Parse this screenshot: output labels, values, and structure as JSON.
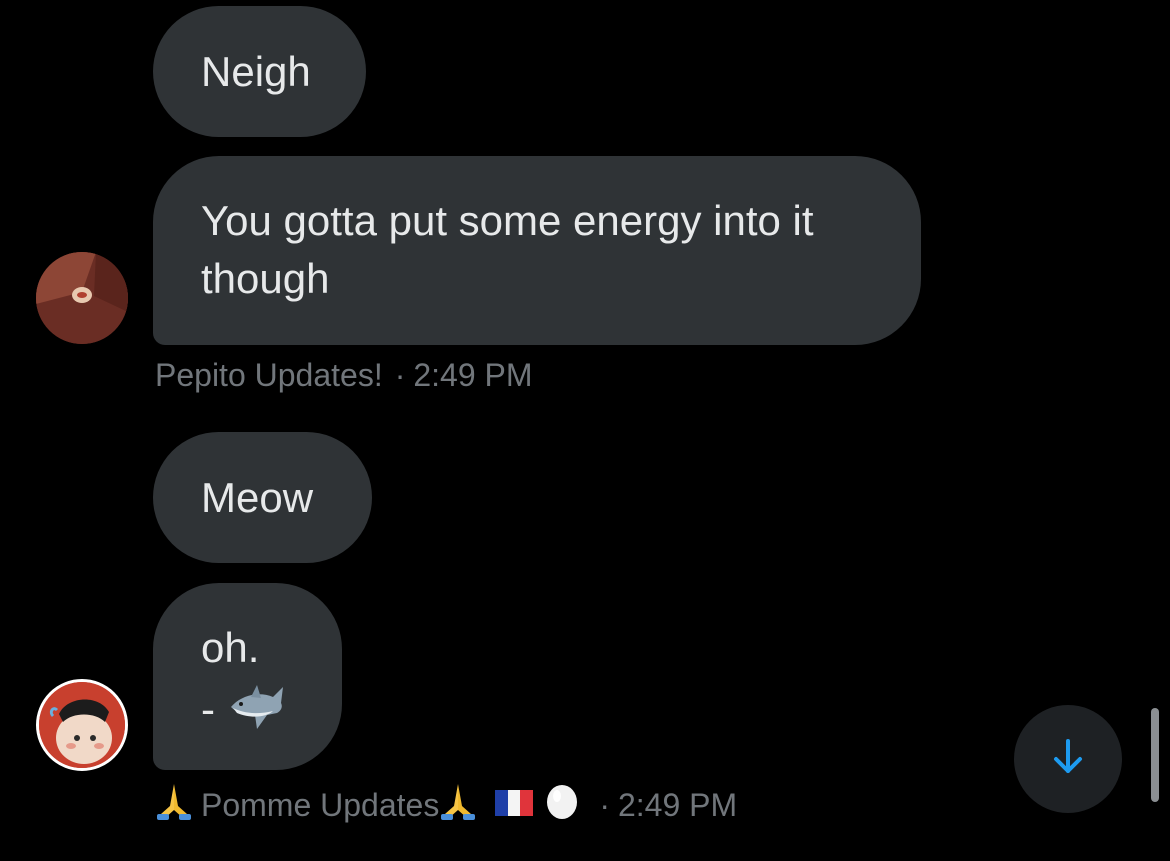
{
  "messages": [
    {
      "text": "Neigh"
    },
    {
      "text": "You gotta put some energy into it though"
    },
    {
      "text": "Meow"
    },
    {
      "line1": "oh.",
      "line2": "-"
    }
  ],
  "meta1": {
    "sender": "Pepito Updates!",
    "separator": "·",
    "time": "2:49 PM"
  },
  "meta2": {
    "sender": "Pomme Updates",
    "separator": "·",
    "time": "2:49 PM"
  },
  "icons": {
    "shark": "shark-icon",
    "pray": "folded-hands-icon",
    "flag": "france-flag-icon",
    "egg": "egg-icon",
    "scroll_down": "arrow-down-icon"
  },
  "colors": {
    "bubble": "#2f3336",
    "text": "#e7e9ea",
    "meta": "#71767b",
    "accent": "#1d9bf0",
    "background": "#000000"
  }
}
